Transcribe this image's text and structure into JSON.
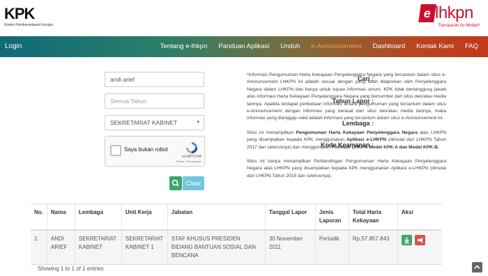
{
  "header": {
    "kpk_logo_text": "KPK",
    "kpk_subtitle": "Komisi Pemberantasan Korupsi",
    "lhkpn_logo_text": "lhkpn",
    "lhkpn_badge": "e",
    "lhkpn_tagline": "Transparan Itu Mudah!"
  },
  "nav": {
    "login": "Login",
    "items": [
      "Tentang e-lhkpn",
      "Panduan Aplikasi",
      "Unduh",
      "e-Announcement",
      "Dashboard",
      "Kontak Kami",
      "FAQ"
    ],
    "active_color": "#f0a04b"
  },
  "form": {
    "cari_label": "Cari :",
    "cari_value": "andi arief",
    "tahun_label": "Tahun Lapor :",
    "tahun_placeholder": "Semua Tahun",
    "lembaga_label": "Lembaga :",
    "lembaga_value": "SEKRETARIAT KABINET",
    "kode_label": "Kode Keamanan :",
    "captcha_text": "Saya bukan robot",
    "captcha_brand": "reCAPTCHA",
    "captcha_terms": "Privasi - Persyaratan",
    "clear_label": "Clear"
  },
  "info": {
    "p1": "*Informasi Pengumuman Harta Kekayaan Penyelenggara Negara yang tercantum dalam situs e-Announcement LHKPN ini adalah sesuai dengan yang telah dilaporkan oleh Penyelenggara Negara dalam LHKPN dan hanya untuk tujuan informasi umum. KPK tidak bertanggung jawab atas informasi Harta Kekayaan Penyelenggara Negara yang bersumber dari situs dan/atau media lainnya. Apabila terdapat perbedaan informasi antara pengumuman yang tercantum dalam situs e-Announcement dengan informasi yang berasal dari situs dan/atau media lainnya, maka informasi yang dianggap valid adalah informasi yang tercantum dalam situs e-Announcement ini.",
    "p2_a": "Situs ini menampilkan ",
    "p2_b": "Pengumuman Harta Kekayaan Penyelenggara Negara",
    "p2_c": " atas LHKPN yang disampaikan kepada KPK menggunakan ",
    "p2_d": "Aplikasi e-LHKPN",
    "p2_e": " (dimulai dari LHKPN Tahun 2017 dan seterusnya) dan menggunakan ",
    "p2_f": "Formulir LHKPN Model KPK-A dan Model KPK-B.",
    "p3": "Situs ini hanya menampilkan Perbandingan Pengumuman Harta Kekayaan Penyelenggara Negara atas LHKPN yang disampaikan kepada KPK menggunakan Aplikasi e-LHKPN (dimulai dari LHKPN Tahun 2018 dan seterusnya)."
  },
  "table": {
    "headers": [
      "No.",
      "Nama",
      "Lembaga",
      "Unit Kerja",
      "Jabatan",
      "Tanggal Lapor",
      "Jenis Laporan",
      "Total Harta Kekayaan",
      "Aksi"
    ],
    "rows": [
      {
        "no": "1.",
        "nama": "ANDI ARIEF",
        "lembaga": "SEKRETARIAT KABINET",
        "unit": "SEKRETARIAT KABINET 1",
        "jabatan": "STAF KHUSUS PRESIDEN BIDANG BANTUAN SOSIAL DAN BENCANA",
        "tanggal": "30 November 2011",
        "jenis": "Periodik",
        "total": "Rp.57.857.843"
      }
    ]
  },
  "footer": {
    "showing": "Showing 1 to 1 of 1 entries"
  }
}
